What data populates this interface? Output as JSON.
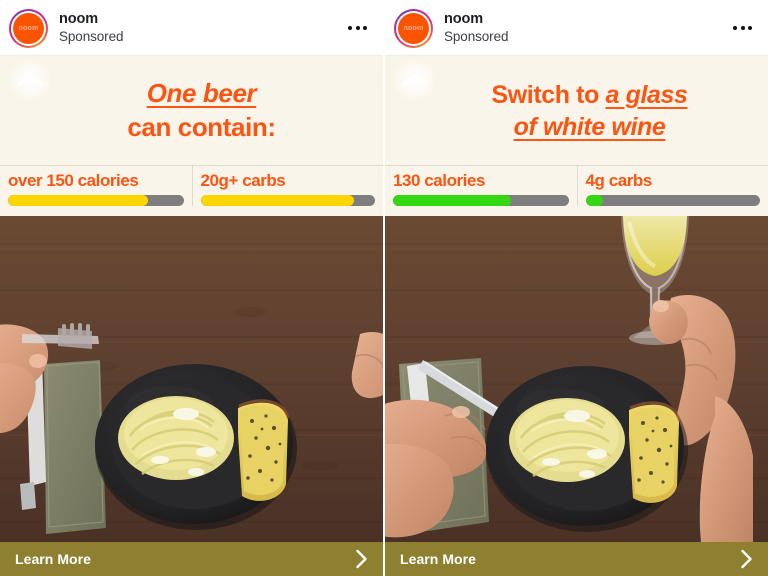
{
  "panels": [
    {
      "header": {
        "avatar_text": "noom",
        "brand": "noom",
        "sponsored": "Sponsored",
        "menu_icon": "ellipsis-icon"
      },
      "collapse_icon": "chevron-up-icon",
      "headline": {
        "emphasis": "One beer",
        "rest": "can contain:"
      },
      "stats": [
        {
          "label": "over 150 calories",
          "fill_percent": 80,
          "fill_color": "#FFD500",
          "track_color": "#7E7E7E"
        },
        {
          "label": "20g+ carbs",
          "fill_percent": 88,
          "fill_color": "#FFD500",
          "track_color": "#7E7E7E"
        }
      ],
      "photo_alt": "overhead shot of pasta and garlic bread on a black plate on a wooden table with hands holding a fork and knife",
      "cta": {
        "label": "Learn More",
        "arrow_icon": "chevron-right-icon"
      }
    },
    {
      "header": {
        "avatar_text": "noom",
        "brand": "noom",
        "sponsored": "Sponsored",
        "menu_icon": "ellipsis-icon"
      },
      "collapse_icon": "chevron-up-icon",
      "headline": {
        "lead": "Switch to ",
        "emphasis_line1": "a glass",
        "emphasis_line2": "of white wine"
      },
      "stats": [
        {
          "label": "130 calories",
          "fill_percent": 67,
          "fill_color": "#35D612",
          "track_color": "#7E7E7E"
        },
        {
          "label": "4g carbs",
          "fill_percent": 10,
          "fill_color": "#35D612",
          "track_color": "#7E7E7E"
        }
      ],
      "photo_alt": "overhead shot of pasta and garlic bread on a black plate with one hand holding a fork and another raising a glass of white wine",
      "cta": {
        "label": "Learn More",
        "arrow_icon": "chevron-right-icon"
      }
    }
  ],
  "theme": {
    "brand_orange": "#FA5512",
    "logo_orange": "#FA5400",
    "cream_bg": "#FAF5EB",
    "cta_bg": "#8D8131",
    "divider": "#DEDAD0"
  }
}
